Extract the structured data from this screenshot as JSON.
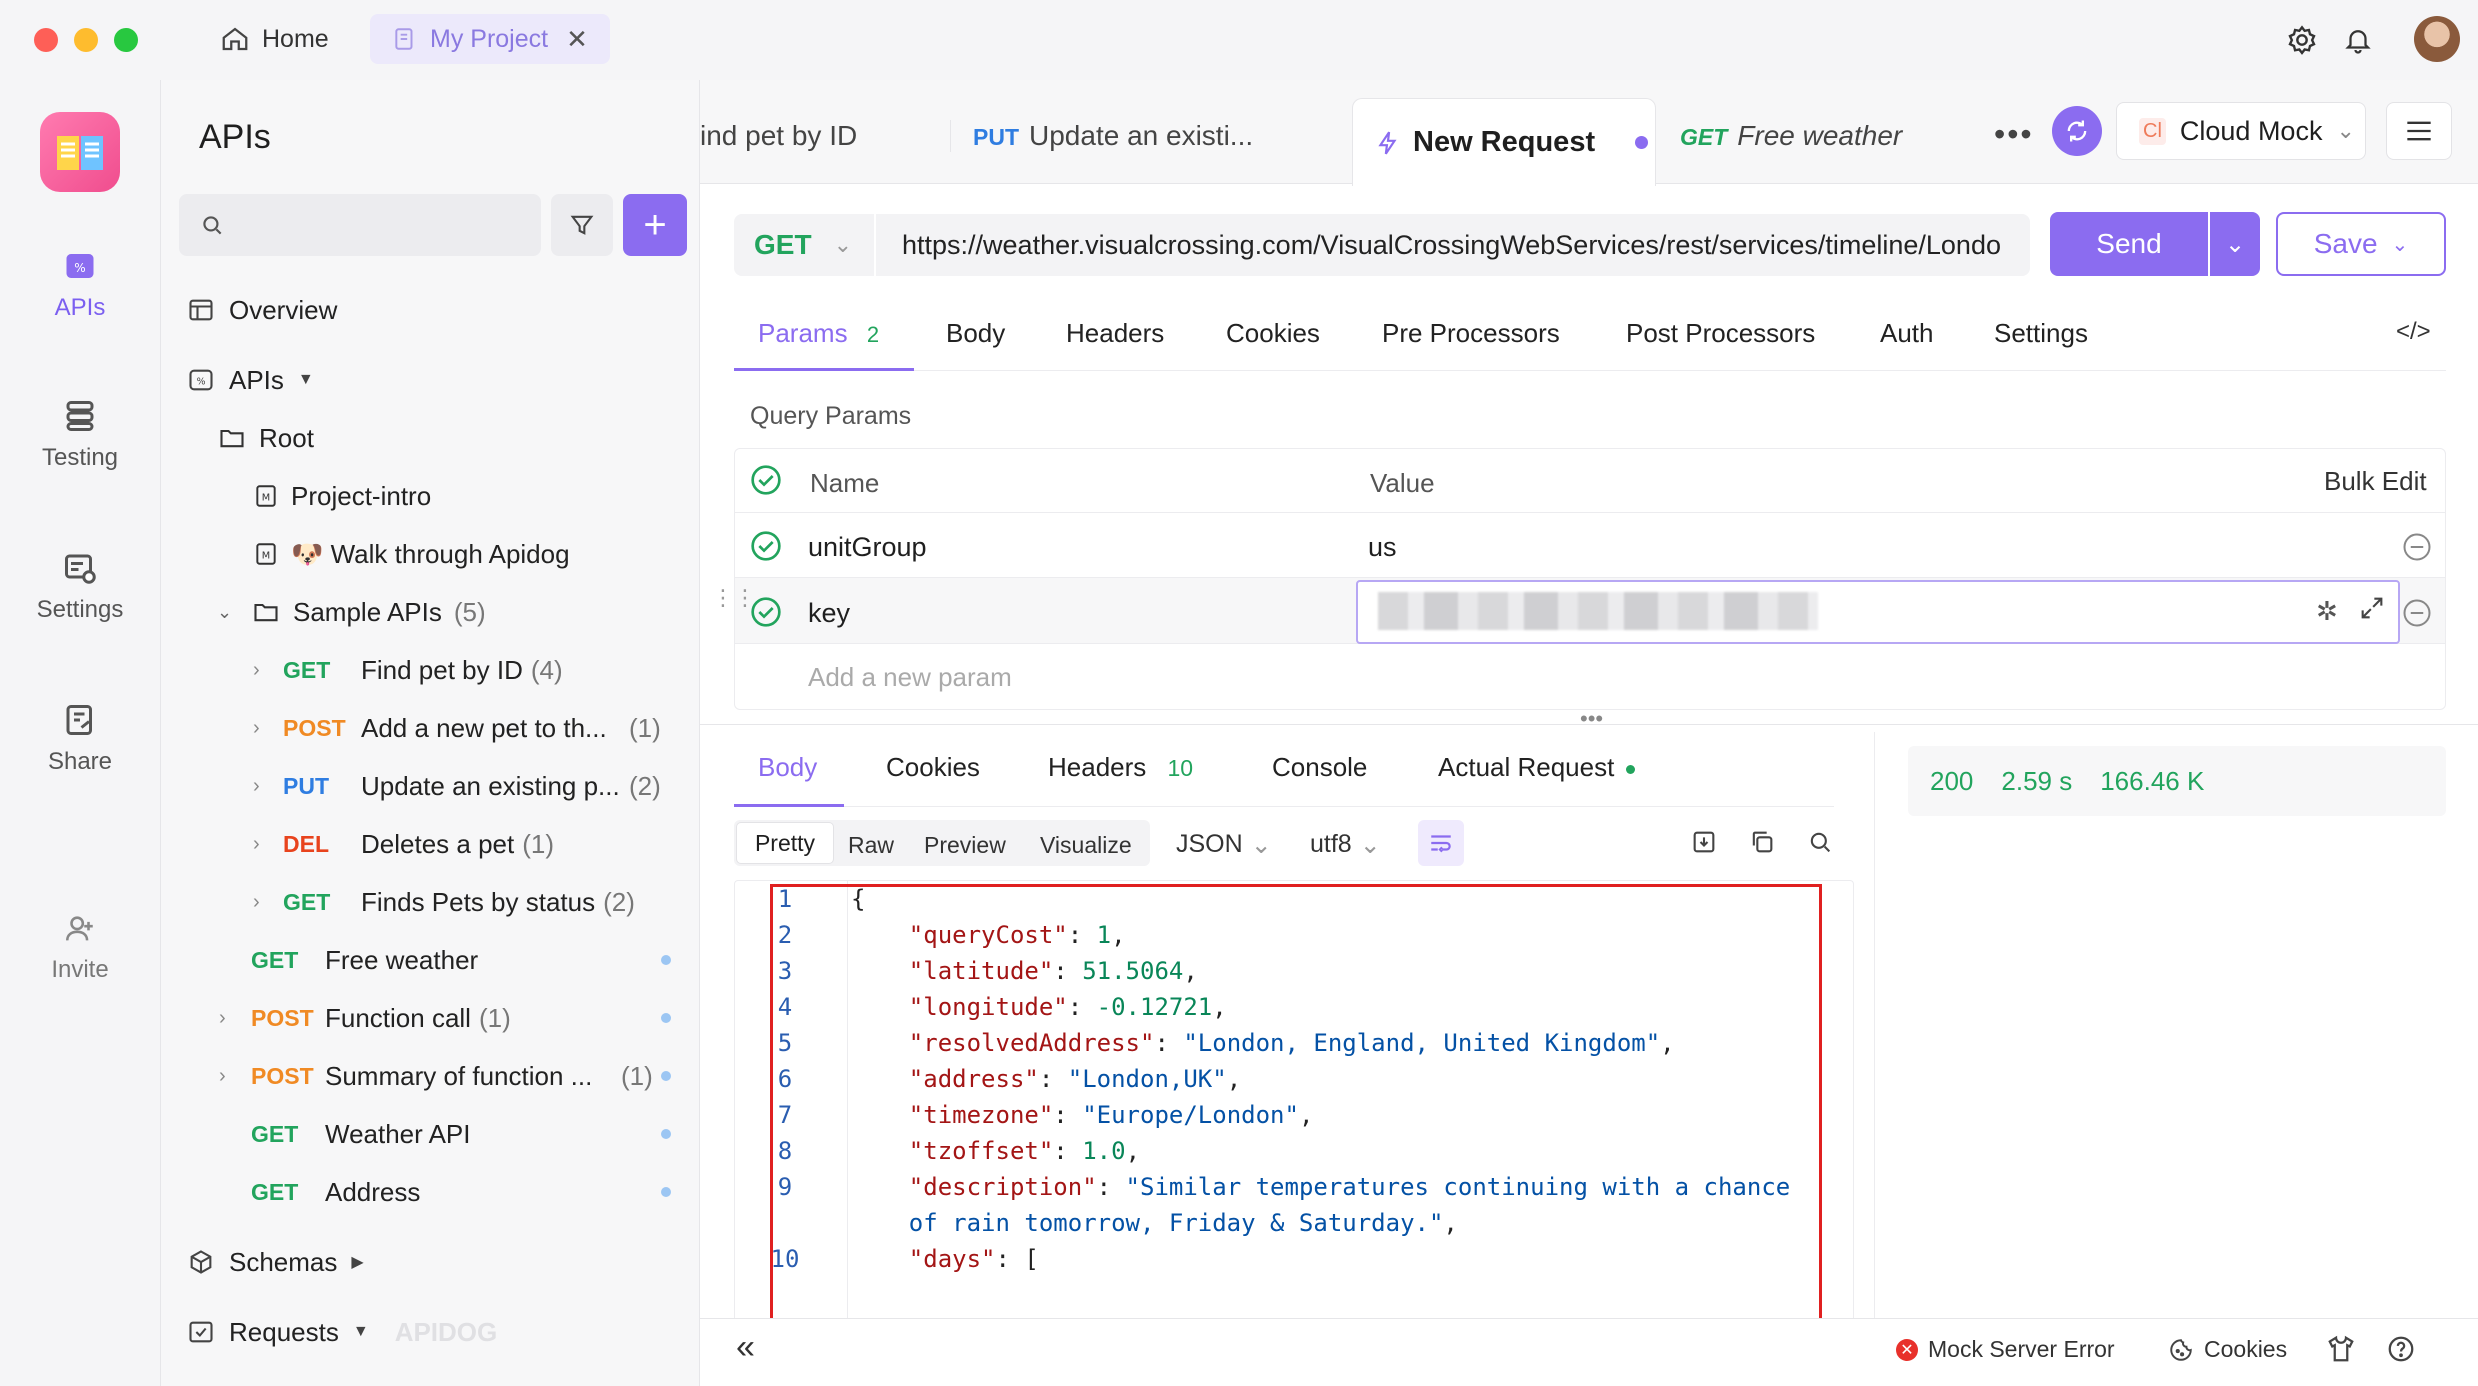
{
  "window": {
    "tabs": [
      {
        "label": "Home"
      },
      {
        "label": "My Project"
      }
    ]
  },
  "rail": {
    "items": [
      {
        "label": "APIs",
        "icon": "apis-icon"
      },
      {
        "label": "Testing",
        "icon": "testing-icon"
      },
      {
        "label": "Settings",
        "icon": "settings-icon"
      },
      {
        "label": "Share",
        "icon": "share-icon"
      },
      {
        "label": "Invite",
        "icon": "invite-icon"
      }
    ]
  },
  "sidebar": {
    "title": "APIs",
    "search_placeholder": "",
    "overview": "Overview",
    "apis_label": "APIs",
    "root": "Root",
    "docs": [
      "Project-intro",
      "🐶 Walk through Apidog"
    ],
    "sample_folder": {
      "label": "Sample APIs",
      "count": "(5)"
    },
    "sample_items": [
      {
        "method": "GET",
        "name": "Find pet by ID",
        "count": "(4)"
      },
      {
        "method": "POST",
        "name": "Add a new pet to th...",
        "count": "(1)"
      },
      {
        "method": "PUT",
        "name": "Update an existing p...",
        "count": "(2)"
      },
      {
        "method": "DEL",
        "name": "Deletes a pet",
        "count": "(1)"
      },
      {
        "method": "GET",
        "name": "Finds Pets by status",
        "count": "(2)"
      }
    ],
    "root_items": [
      {
        "method": "GET",
        "name": "Free weather",
        "count": ""
      },
      {
        "method": "POST",
        "name": "Function call",
        "count": "(1)"
      },
      {
        "method": "POST",
        "name": "Summary of function ...",
        "count": "(1)"
      },
      {
        "method": "GET",
        "name": "Weather API",
        "count": ""
      },
      {
        "method": "GET",
        "name": "Address",
        "count": ""
      }
    ],
    "schemas": "Schemas",
    "requests": "Requests",
    "watermark": "APIDOG"
  },
  "request_tabs": [
    {
      "method": "",
      "label": "ind pet by ID"
    },
    {
      "method": "PUT",
      "label": "Update an existi..."
    },
    {
      "method": "",
      "label": "New Request"
    },
    {
      "method": "GET",
      "label": "Free weather"
    }
  ],
  "env": {
    "badge": "Cl",
    "label": "Cloud Mock"
  },
  "request": {
    "method": "GET",
    "url": "https://weather.visualcrossing.com/VisualCrossingWebServices/rest/services/timeline/Londo",
    "send": "Send",
    "save": "Save"
  },
  "param_tabs": [
    {
      "label": "Params",
      "count": "2"
    },
    {
      "label": "Body",
      "count": ""
    },
    {
      "label": "Headers",
      "count": ""
    },
    {
      "label": "Cookies",
      "count": ""
    },
    {
      "label": "Pre Processors",
      "count": ""
    },
    {
      "label": "Post Processors",
      "count": ""
    },
    {
      "label": "Auth",
      "count": ""
    },
    {
      "label": "Settings",
      "count": ""
    }
  ],
  "query": {
    "title": "Query Params",
    "col_name": "Name",
    "col_value": "Value",
    "bulk_edit": "Bulk Edit",
    "rows": [
      {
        "name": "unitGroup",
        "value": "us"
      },
      {
        "name": "key",
        "value": ""
      }
    ],
    "add_placeholder": "Add a new param"
  },
  "response_tabs": [
    {
      "label": "Body",
      "count": ""
    },
    {
      "label": "Cookies",
      "count": ""
    },
    {
      "label": "Headers",
      "count": "10"
    },
    {
      "label": "Console",
      "count": ""
    },
    {
      "label": "Actual Request",
      "count": ""
    }
  ],
  "view_modes": [
    "Pretty",
    "Raw",
    "Preview",
    "Visualize"
  ],
  "format": "JSON",
  "encoding": "utf8",
  "status": {
    "code": "200",
    "time": "2.59 s",
    "size": "166.46 K"
  },
  "code_lines": [
    {
      "n": "1",
      "indent": "",
      "key": "",
      "val": "",
      "vtype": "",
      "tail": "{"
    },
    {
      "n": "2",
      "indent": "    ",
      "key": "\"queryCost\"",
      "val": "1",
      "vtype": "n",
      "tail": ","
    },
    {
      "n": "3",
      "indent": "    ",
      "key": "\"latitude\"",
      "val": "51.5064",
      "vtype": "n",
      "tail": ","
    },
    {
      "n": "4",
      "indent": "    ",
      "key": "\"longitude\"",
      "val": "-0.12721",
      "vtype": "n",
      "tail": ","
    },
    {
      "n": "5",
      "indent": "    ",
      "key": "\"resolvedAddress\"",
      "val": "\"London, England, United Kingdom\"",
      "vtype": "s",
      "tail": ","
    },
    {
      "n": "6",
      "indent": "    ",
      "key": "\"address\"",
      "val": "\"London,UK\"",
      "vtype": "s",
      "tail": ","
    },
    {
      "n": "7",
      "indent": "    ",
      "key": "\"timezone\"",
      "val": "\"Europe/London\"",
      "vtype": "s",
      "tail": ","
    },
    {
      "n": "8",
      "indent": "    ",
      "key": "\"tzoffset\"",
      "val": "1.0",
      "vtype": "n",
      "tail": ","
    },
    {
      "n": "9",
      "indent": "    ",
      "key": "\"description\"",
      "val": "\"Similar temperatures continuing with a chance",
      "vtype": "s",
      "tail": ""
    },
    {
      "n": "",
      "indent": "    ",
      "key": "",
      "val": "of rain tomorrow, Friday & Saturday.\"",
      "vtype": "s",
      "tail": ","
    },
    {
      "n": "10",
      "indent": "    ",
      "key": "\"days\"",
      "val": "",
      "vtype": "",
      "tail": "["
    }
  ],
  "footer": {
    "mock_error": "Mock Server Error",
    "cookies": "Cookies"
  },
  "colors": {
    "accent": "#8b6cf0",
    "get": "#22a45d",
    "post": "#f08a24",
    "put": "#2f7de1",
    "del": "#e8431d",
    "highlight_border": "#e02020"
  }
}
